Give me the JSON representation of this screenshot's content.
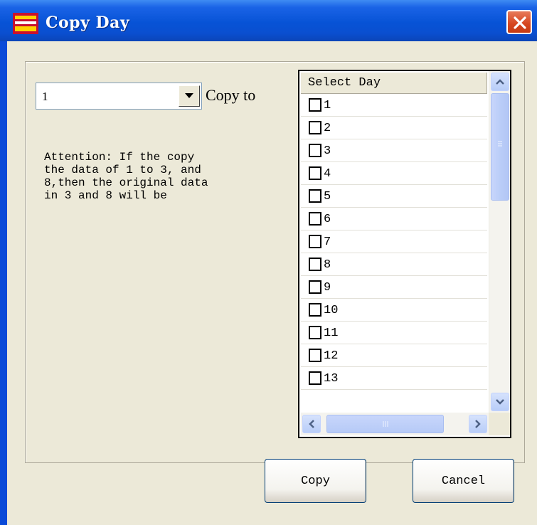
{
  "window": {
    "title": "Copy Day",
    "icon_name": "app-icon",
    "close_icon": "close-icon"
  },
  "source_combo": {
    "selected": "1",
    "arrow_icon": "chevron-down-icon"
  },
  "copy_to_label": "Copy to",
  "attention_text": "Attention: If the copy\nthe data of 1 to 3, and\n8,then the original data\nin 3 and 8 will be",
  "day_list": {
    "header": "Select Day",
    "items": [
      {
        "label": "1",
        "checked": false
      },
      {
        "label": "2",
        "checked": false
      },
      {
        "label": "3",
        "checked": false
      },
      {
        "label": "4",
        "checked": false
      },
      {
        "label": "5",
        "checked": false
      },
      {
        "label": "6",
        "checked": false
      },
      {
        "label": "7",
        "checked": false
      },
      {
        "label": "8",
        "checked": false
      },
      {
        "label": "9",
        "checked": false
      },
      {
        "label": "10",
        "checked": false
      },
      {
        "label": "11",
        "checked": false
      },
      {
        "label": "12",
        "checked": false
      },
      {
        "label": "13",
        "checked": false
      }
    ]
  },
  "buttons": {
    "copy": "Copy",
    "cancel": "Cancel"
  },
  "colors": {
    "titlebar": "#0753d6",
    "dialog_face": "#ece9d8",
    "close_button": "#d6451e",
    "scroll_accent": "#b8cdf8"
  }
}
